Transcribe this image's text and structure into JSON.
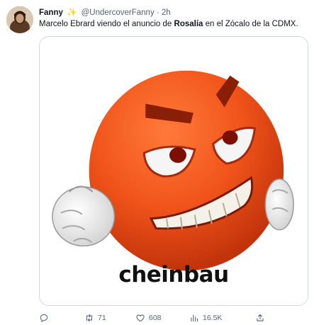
{
  "tweet": {
    "display_name": "Fanny",
    "badge_emoji": "✨",
    "handle": "@UndercoverFanny",
    "separator": "·",
    "time": "2h",
    "text_before": "Marcelo Ebrard viendo el anuncio de ",
    "text_bold": "Rosalía",
    "text_after": " en el Zócalo de la CDMX.",
    "image_caption": "cheinbau"
  },
  "actions": {
    "reply_count": "",
    "retweet_count": "71",
    "like_count": "608",
    "views_count": "16.5K"
  },
  "colors": {
    "text": "#0f1419",
    "secondary": "#536471",
    "border": "#cfd9de",
    "emoji_orange": "#f1541a"
  },
  "icons": [
    "reply-icon",
    "retweet-icon",
    "like-icon",
    "views-icon",
    "share-icon",
    "sparkles-icon"
  ]
}
